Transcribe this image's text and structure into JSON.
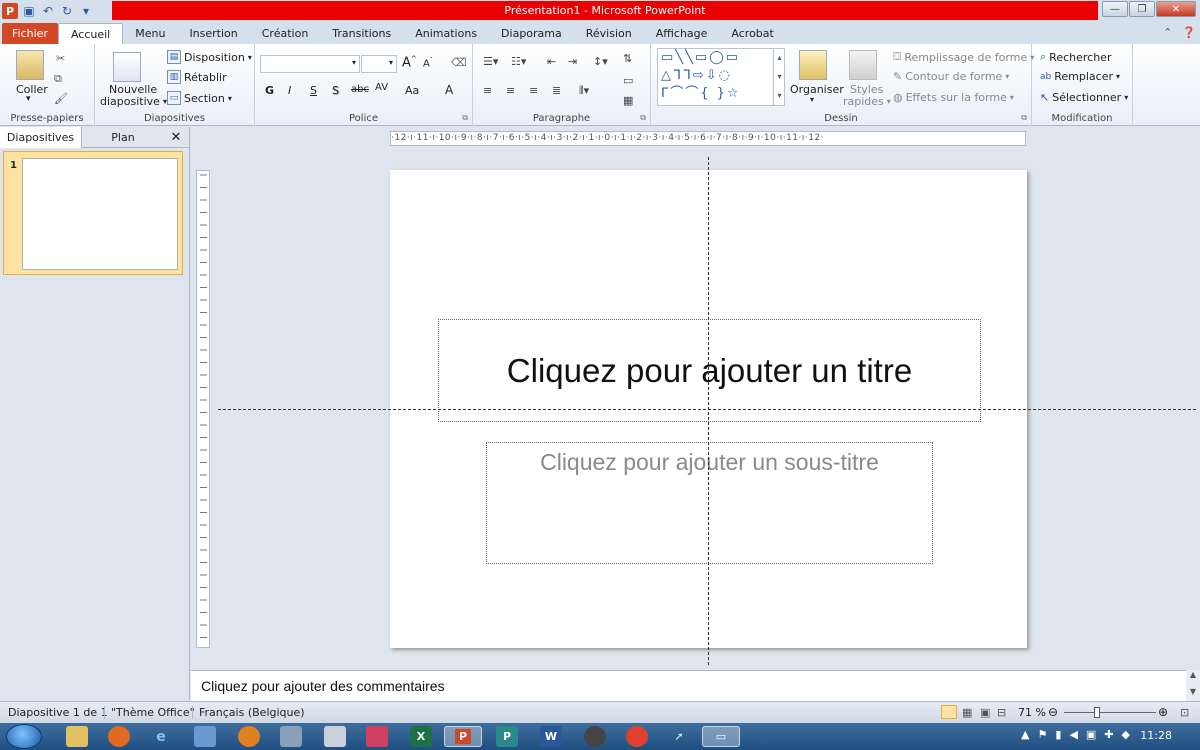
{
  "window": {
    "title": "Présentation1  -  Microsoft PowerPoint",
    "app_letter": "P"
  },
  "tabs": [
    "Fichier",
    "Accueil",
    "Menu",
    "Insertion",
    "Création",
    "Transitions",
    "Animations",
    "Diaporama",
    "Révision",
    "Affichage",
    "Acrobat"
  ],
  "ribbon": {
    "clipboard": {
      "paste": "Coller",
      "label": "Presse-papiers"
    },
    "slides": {
      "new_line1": "Nouvelle",
      "new_line2": "diapositive",
      "layout": "Disposition",
      "reset": "Rétablir",
      "section": "Section",
      "label": "Diapositives"
    },
    "font": {
      "label": "Police",
      "bold": "G",
      "italic": "I",
      "underline": "S",
      "strike": "S",
      "abc": "abc",
      "av": "AV",
      "aa": "Aa",
      "a": "A"
    },
    "paragraph": {
      "label": "Paragraphe"
    },
    "drawing": {
      "arrange": "Organiser",
      "styles_line1": "Styles",
      "styles_line2": "rapides",
      "fill": "Remplissage de forme",
      "outline": "Contour de forme",
      "effects": "Effets sur la forme",
      "label": "Dessin"
    },
    "editing": {
      "find": "Rechercher",
      "replace": "Remplacer",
      "select": "Sélectionner",
      "label": "Modification"
    }
  },
  "left_panel": {
    "tab_slides": "Diapositives",
    "tab_outline": "Plan",
    "slide_number": "1"
  },
  "hruler_text": "·12·ı·11·ı·10·ı·9·ı·8·ı·7·ı·6·ı·5·ı·4·ı·3·ı·2·ı·1·ı·0·ı·1·ı·2·ı·3·ı·4·ı·5·ı·6·ı·7·ı·8·ı·9·ı·10·ı·11·ı·12·",
  "slide": {
    "title_placeholder": "Cliquez pour ajouter un titre",
    "subtitle_placeholder": "Cliquez pour ajouter un sous-titre"
  },
  "notes_placeholder": "Cliquez pour ajouter des commentaires",
  "status": {
    "slide_count": "Diapositive 1 de 1",
    "theme": "\"Thème Office\"",
    "language": "Français (Belgique)",
    "zoom": "71 %"
  },
  "taskbar": {
    "clock": "11:28"
  }
}
